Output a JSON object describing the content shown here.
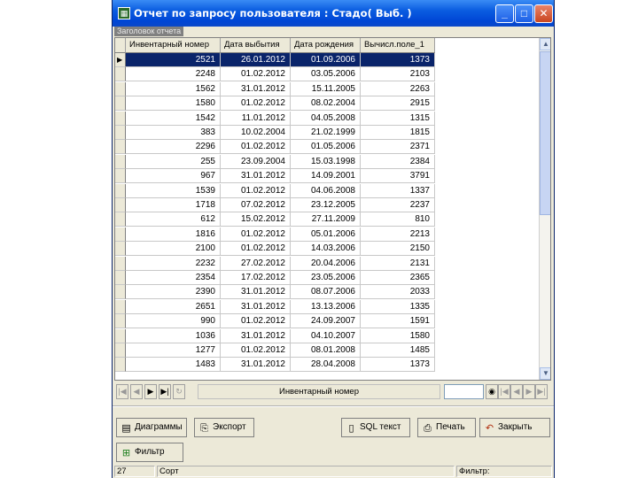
{
  "window": {
    "title": "Отчет по запросу пользователя : Стадо( Выб.  )",
    "icon": "report-app-icon",
    "controls": [
      "minimize",
      "maximize",
      "close"
    ]
  },
  "report": {
    "caption": "Заголовок отчета"
  },
  "table": {
    "columns": [
      "Инвентарный номер",
      "Дата выбытия",
      "Дата рождения",
      "Вычисл.поле_1"
    ],
    "rows": [
      [
        "2521",
        "26.01.2012",
        "01.09.2006",
        "1373"
      ],
      [
        "2248",
        "01.02.2012",
        "03.05.2006",
        "2103"
      ],
      [
        "1562",
        "31.01.2012",
        "15.11.2005",
        "2263"
      ],
      [
        "1580",
        "01.02.2012",
        "08.02.2004",
        "2915"
      ],
      [
        "1542",
        "11.01.2012",
        "04.05.2008",
        "1315"
      ],
      [
        "383",
        "10.02.2004",
        "21.02.1999",
        "1815"
      ],
      [
        "2296",
        "01.02.2012",
        "01.05.2006",
        "2371"
      ],
      [
        "255",
        "23.09.2004",
        "15.03.1998",
        "2384"
      ],
      [
        "967",
        "31.01.2012",
        "14.09.2001",
        "3791"
      ],
      [
        "1539",
        "01.02.2012",
        "04.06.2008",
        "1337"
      ],
      [
        "1718",
        "07.02.2012",
        "23.12.2005",
        "2237"
      ],
      [
        "612",
        "15.02.2012",
        "27.11.2009",
        "810"
      ],
      [
        "1816",
        "01.02.2012",
        "05.01.2006",
        "2213"
      ],
      [
        "2100",
        "01.02.2012",
        "14.03.2006",
        "2150"
      ],
      [
        "2232",
        "27.02.2012",
        "20.04.2006",
        "2131"
      ],
      [
        "2354",
        "17.02.2012",
        "23.05.2006",
        "2365"
      ],
      [
        "2390",
        "31.01.2012",
        "08.07.2006",
        "2033"
      ],
      [
        "2651",
        "31.01.2012",
        "13.13.2006",
        "1335"
      ],
      [
        "990",
        "01.02.2012",
        "24.09.2007",
        "1591"
      ],
      [
        "1036",
        "31.01.2012",
        "04.10.2007",
        "1580"
      ],
      [
        "1277",
        "01.02.2012",
        "08.01.2008",
        "1485"
      ],
      [
        "1483",
        "31.01.2012",
        "28.04.2008",
        "1373"
      ]
    ],
    "selected_row": 0
  },
  "navigator": {
    "field_label": "Инвентарный номер",
    "search_value": ""
  },
  "toolbar": {
    "diagrams_label": "Диаграммы",
    "export_label": "Экспорт",
    "sql_label": "SQL текст",
    "print_label": "Печать",
    "close_label": "Закрыть",
    "filter_label": "Фильтр"
  },
  "status": {
    "count": "27",
    "sort_label": "Сорт",
    "filter_label": "Фильтр:"
  },
  "colors": {
    "titlebar": "#0a5ce0",
    "selection": "#0a246a",
    "window_bg": "#ece9d8"
  }
}
